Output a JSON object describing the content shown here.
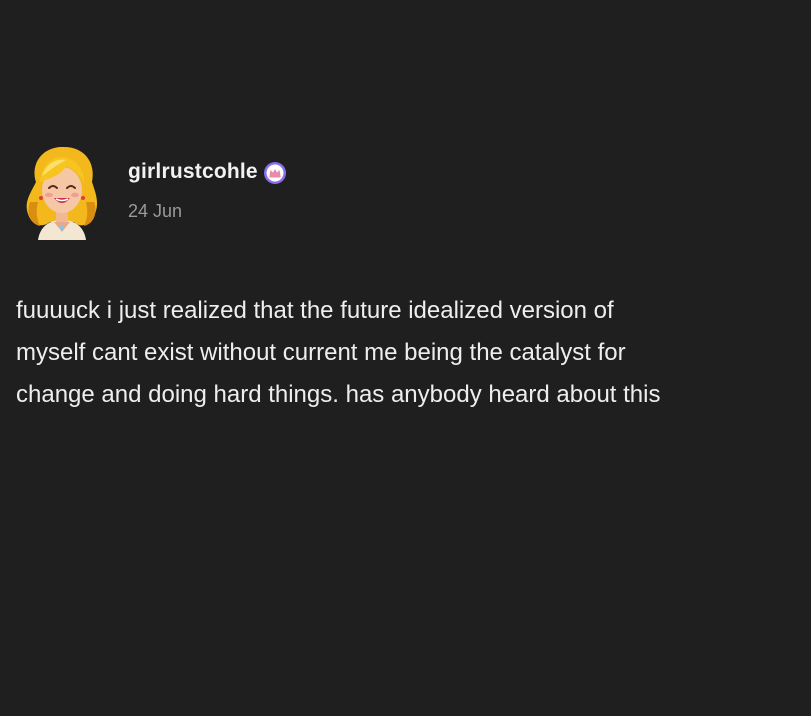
{
  "post": {
    "author": {
      "username": "girlrustcohle",
      "avatar_icon": "cartoon-blonde-woman-avatar",
      "badge_icon": "crown-badge-icon",
      "badge_color": "#8a6cf0"
    },
    "date": "24 Jun",
    "body_lines": [
      "fuuuuck i just realized that the future idealized version of",
      "myself cant exist without current me being the catalyst for",
      "change and doing hard things. has anybody heard about this"
    ]
  },
  "theme": {
    "background": "#1f1f1f",
    "text": "#eeeeee",
    "muted": "#9a9a9a"
  }
}
